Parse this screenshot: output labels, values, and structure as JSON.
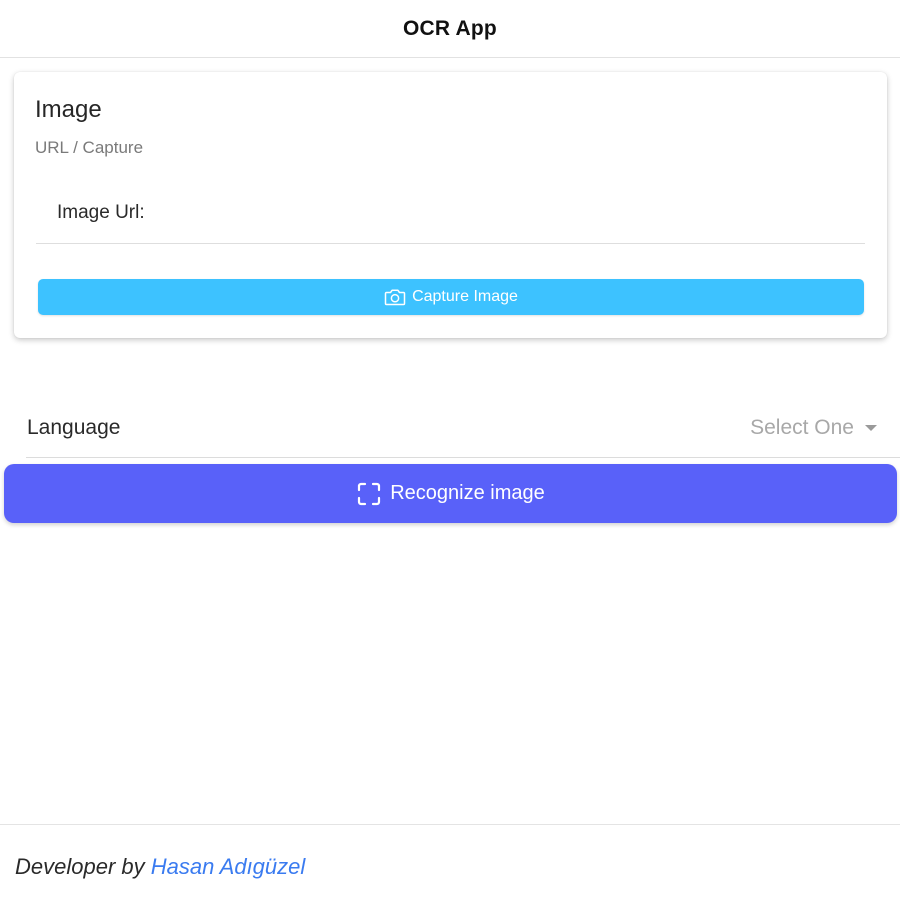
{
  "header": {
    "title": "OCR App"
  },
  "image_card": {
    "title": "Image",
    "subtitle": "URL / Capture",
    "url_label": "Image Url:",
    "url_value": "",
    "capture_label": "Capture Image",
    "capture_icon": "camera-icon",
    "capture_color": "#3dc2ff"
  },
  "language": {
    "label": "Language",
    "placeholder": "Select One",
    "caret_icon": "caret-down-icon"
  },
  "recognize": {
    "label": "Recognize image",
    "icon": "scan-icon",
    "color": "#5961f9"
  },
  "footer": {
    "prefix": "Developer by ",
    "author": "Hasan Adıgüzel",
    "link_color": "#3a7bf0"
  }
}
